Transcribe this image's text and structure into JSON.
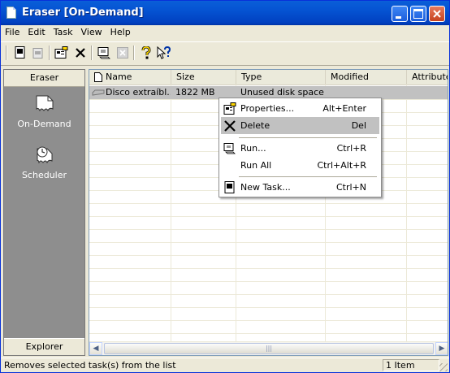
{
  "window": {
    "title": "Eraser  [On-Demand]"
  },
  "menubar": {
    "items": [
      "File",
      "Edit",
      "Task",
      "View",
      "Help"
    ]
  },
  "toolbar": {
    "buttons": [
      "new-task-icon",
      "disabled-doc-icon",
      "properties-icon",
      "delete-icon",
      "run-icon",
      "stop-icon",
      "help-icon",
      "context-help-icon"
    ]
  },
  "sidebar": {
    "header": "Eraser",
    "items": [
      {
        "label": "On-Demand",
        "icon": "on-demand-icon"
      },
      {
        "label": "Scheduler",
        "icon": "scheduler-icon"
      }
    ],
    "footer": "Explorer"
  },
  "listview": {
    "columns": [
      "Name",
      "Size",
      "Type",
      "Modified",
      "Attributes"
    ],
    "rows": [
      {
        "name": "Disco extraíbl...",
        "size": "1822 MB",
        "type": "Unused disk space",
        "modified": "",
        "attributes": ""
      }
    ]
  },
  "context_menu": {
    "items": [
      {
        "label": "Properties...",
        "shortcut": "Alt+Enter",
        "icon": "properties-icon"
      },
      {
        "label": "Delete",
        "shortcut": "Del",
        "icon": "delete-icon",
        "selected": true
      },
      {
        "label": "Run...",
        "shortcut": "Ctrl+R",
        "icon": "run-icon"
      },
      {
        "label": "Run All",
        "shortcut": "Ctrl+Alt+R",
        "icon": ""
      },
      {
        "label": "New Task...",
        "shortcut": "Ctrl+N",
        "icon": "new-task-icon"
      }
    ]
  },
  "statusbar": {
    "message": "Removes selected task(s) from the list",
    "count": "1 Item"
  },
  "colors": {
    "titlebar": "#0553d2",
    "sidebar": "#8e8e8e",
    "selection": "#c1c1c1"
  }
}
